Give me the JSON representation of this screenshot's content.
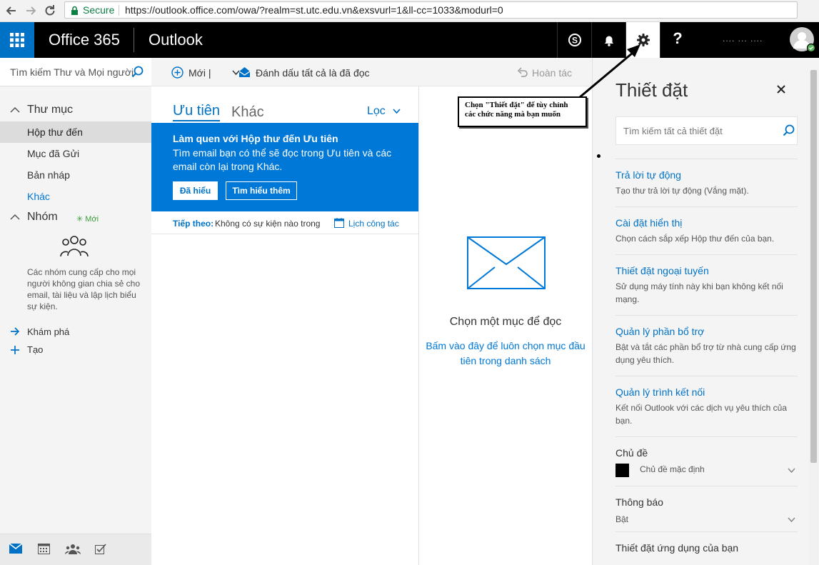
{
  "browser": {
    "secure_label": "Secure",
    "url": "https://outlook.office.com/owa/?realm=st.utc.edu.vn&exsvurl=1&ll-cc=1033&modurl=0"
  },
  "suite": {
    "brand": "Office 365",
    "app": "Outlook",
    "help_label": "?",
    "username": ".... ... ...."
  },
  "left": {
    "search_placeholder": "Tìm kiếm Thư và Mọi người",
    "folders_heading": "Thư mục",
    "folders": [
      "Hộp thư đến",
      "Mục đã Gửi",
      "Bản nháp",
      "Khác"
    ],
    "groups_heading": "Nhóm",
    "groups_new": "Mới",
    "groups_desc": "Các nhóm cung cấp cho mọi người không gian chia sẻ cho email, tài liệu và lập lịch biểu sự kiện.",
    "explore": "Khám phá",
    "create": "Tạo"
  },
  "commands": {
    "new": "Mới |",
    "mark_all_read": "Đánh dấu tất cả là đã đọc",
    "undo": "Hoàn tác"
  },
  "list": {
    "tab_focused": "Ưu tiên",
    "tab_other": "Khác",
    "filter": "Lọc",
    "banner_title": "Làm quen với Hộp thư đến Ưu tiên",
    "banner_text": "Tìm email bạn có thể sẽ đọc trong Ưu tiên và các email còn lại trong Khác.",
    "banner_ok": "Đã hiểu",
    "banner_learn": "Tìm hiểu thêm",
    "next_label": "Tiếp theo:",
    "next_text": "Không có sự kiện nào trong",
    "calendar_link": "Lịch công tác"
  },
  "reading": {
    "title": "Chọn một mục để đọc",
    "link": "Bấm vào đây để luôn chọn mục đầu tiên trong danh sách"
  },
  "settings": {
    "title": "Thiết đặt",
    "search_placeholder": "Tìm kiếm tất cả thiết đặt",
    "items": [
      {
        "link": "Trả lời tự động",
        "desc": "Tạo thư trả lời tự động (Vắng mặt)."
      },
      {
        "link": "Cài đặt hiển thị",
        "desc": "Chọn cách sắp xếp Hộp thư đến của bạn."
      },
      {
        "link": "Thiết đặt ngoại tuyến",
        "desc": "Sử dụng máy tính này khi bạn không kết nối mạng."
      },
      {
        "link": "Quản lý phần bổ trợ",
        "desc": "Bật và tắt các phần bổ trợ từ nhà cung cấp ứng dụng yêu thích."
      },
      {
        "link": "Quản lý trình kết nối",
        "desc": "Kết nối Outlook với các dịch vụ yêu thích của bạn."
      }
    ],
    "theme_heading": "Chủ đề",
    "theme_value": "Chủ đề mặc định",
    "notify_heading": "Thông báo",
    "notify_value": "Bật",
    "app_settings_heading": "Thiết đặt ứng dụng của bạn"
  },
  "annotation": {
    "text": "Chọn \"Thiết đặt\" để tùy chỉnh các chức năng mà bạn muốn"
  },
  "colors": {
    "accent": "#0072c6",
    "banner": "#0078d7",
    "suite_bar": "#000000"
  }
}
